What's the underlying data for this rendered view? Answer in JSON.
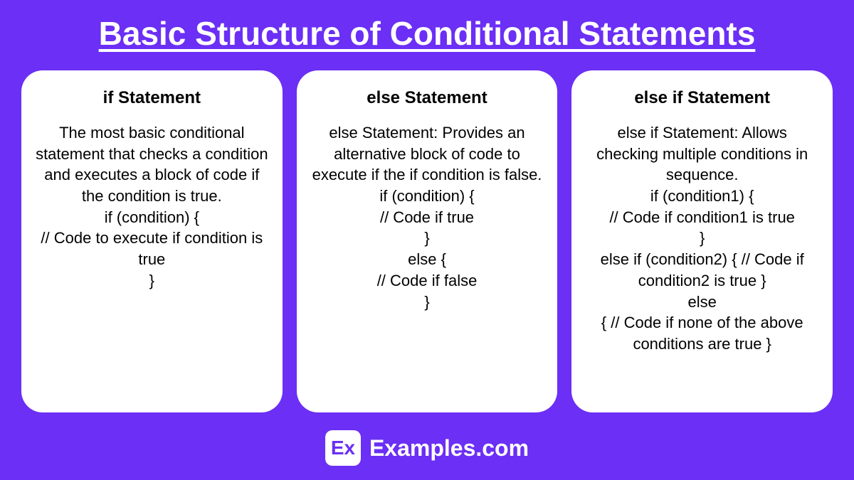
{
  "title": "Basic Structure of Conditional Statements",
  "cards": [
    {
      "title": "if Statement",
      "body": "The most basic conditional statement that checks a condition and executes a block of code if the condition is true.\nif (condition) {\n// Code to execute if condition is true\n}"
    },
    {
      "title": "else Statement",
      "body": "else Statement: Provides an alternative block of code to execute if the if condition is false.\nif (condition) {\n// Code if true\n}\nelse {\n// Code if false\n}"
    },
    {
      "title": "else if Statement",
      "body": "else if Statement: Allows checking multiple conditions in sequence.\nif (condition1) {\n// Code if condition1 is true\n}\nelse if (condition2) { // Code if condition2 is true }\nelse\n{ // Code if none of the above conditions are true }"
    }
  ],
  "footer": {
    "icon": "Ex",
    "text": "Examples.com"
  }
}
